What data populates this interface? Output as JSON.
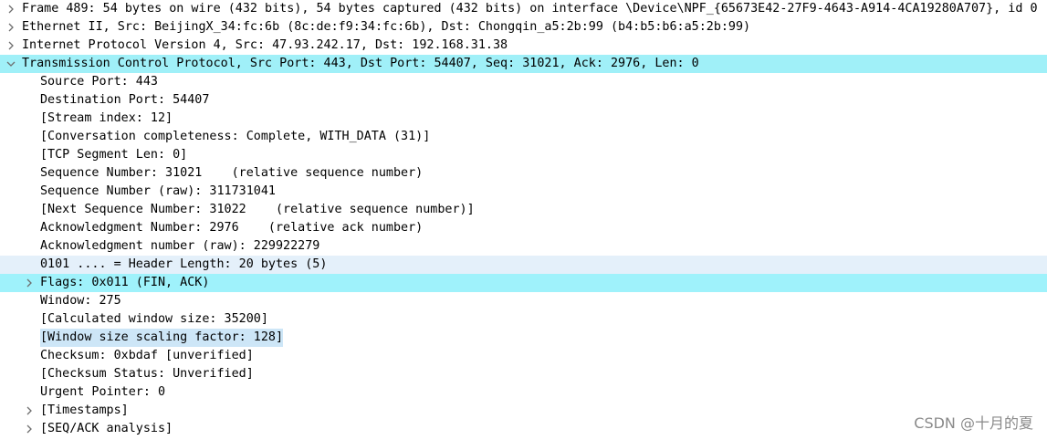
{
  "tree": {
    "frame": "Frame 489: 54 bytes on wire (432 bits), 54 bytes captured (432 bits) on interface \\Device\\NPF_{65673E42-27F9-4643-A914-4CA19280A707}, id 0",
    "ethernet": "Ethernet II, Src: BeijingX_34:fc:6b (8c:de:f9:34:fc:6b), Dst: Chongqin_a5:2b:99 (b4:b5:b6:a5:2b:99)",
    "ip": "Internet Protocol Version 4, Src: 47.93.242.17, Dst: 192.168.31.38",
    "tcp": "Transmission Control Protocol, Src Port: 443, Dst Port: 54407, Seq: 31021, Ack: 2976, Len: 0",
    "tcp_fields": {
      "src_port": "Source Port: 443",
      "dst_port": "Destination Port: 54407",
      "stream_index": "[Stream index: 12]",
      "conversation": "[Conversation completeness: Complete, WITH_DATA (31)]",
      "segment_len": "[TCP Segment Len: 0]",
      "seq": "Sequence Number: 31021    (relative sequence number)",
      "seq_raw": "Sequence Number (raw): 311731041",
      "next_seq": "[Next Sequence Number: 31022    (relative sequence number)]",
      "ack": "Acknowledgment Number: 2976    (relative ack number)",
      "ack_raw": "Acknowledgment number (raw): 229922279",
      "header_len": "0101 .... = Header Length: 20 bytes (5)",
      "flags": "Flags: 0x011 (FIN, ACK)",
      "window": "Window: 275",
      "calc_window": "[Calculated window size: 35200]",
      "scaling": "[Window size scaling factor: 128]",
      "checksum": "Checksum: 0xbdaf [unverified]",
      "checksum_status": "[Checksum Status: Unverified]",
      "urgent": "Urgent Pointer: 0",
      "timestamps": "[Timestamps]",
      "seq_ack": "[SEQ/ACK analysis]"
    }
  },
  "watermark": "CSDN @十月的夏",
  "colors": {
    "selected_band": "#a0f0f8",
    "related_band": "#e4f0fa",
    "highlight_field": "#cde6f7",
    "arrow": "#6f6f6f"
  },
  "icons": {
    "collapsed": "chevron-right-icon",
    "expanded": "chevron-down-icon"
  }
}
